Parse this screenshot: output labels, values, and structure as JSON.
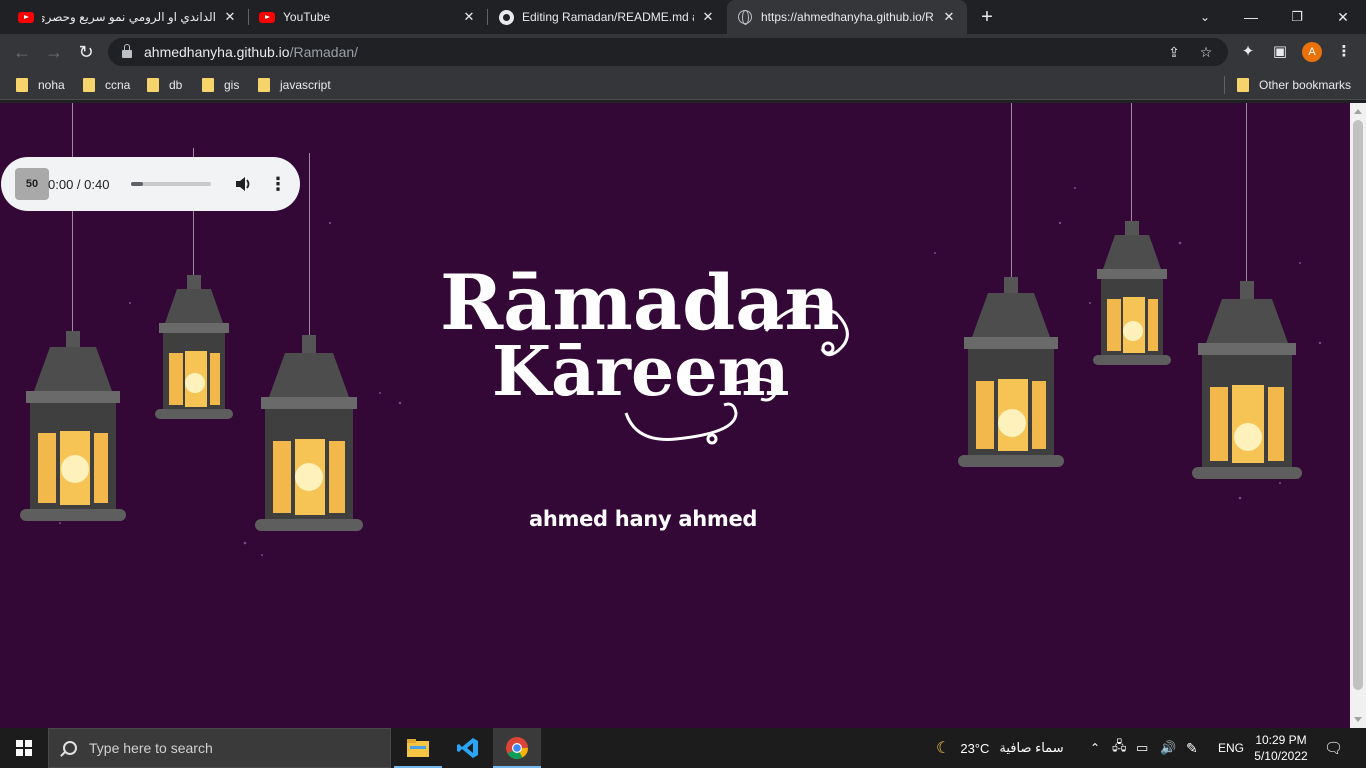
{
  "tabs": [
    {
      "title": "الداندي او الرومي نمو سريع وحصري",
      "icon": "youtube-icon"
    },
    {
      "title": "YouTube",
      "icon": "youtube-icon"
    },
    {
      "title": "Editing Ramadan/README.md at",
      "icon": "github-icon"
    },
    {
      "title": "https://ahmedhanyha.github.io/R",
      "icon": "globe-icon",
      "active": true
    }
  ],
  "address": {
    "host": "ahmedhanyha.github.io",
    "path": "/Ramadan/"
  },
  "bookmarks": [
    {
      "label": "noha"
    },
    {
      "label": "ccna"
    },
    {
      "label": "db"
    },
    {
      "label": "gis"
    },
    {
      "label": "javascript"
    }
  ],
  "other_bookmarks": "Other bookmarks",
  "profile_initial": "A",
  "audio": {
    "play_overlay": "50",
    "time": "0:00 / 0:40",
    "progress": 0.15
  },
  "page": {
    "title_line1": "Rāmadan",
    "title_line2": "Kāreem",
    "author": "ahmed hany ahmed",
    "background": "#330736"
  },
  "taskbar": {
    "search_placeholder": "Type here to search",
    "weather_temp": "23°C",
    "weather_text": "سماء صافية",
    "language": "ENG",
    "time": "10:29 PM",
    "date": "5/10/2022"
  }
}
